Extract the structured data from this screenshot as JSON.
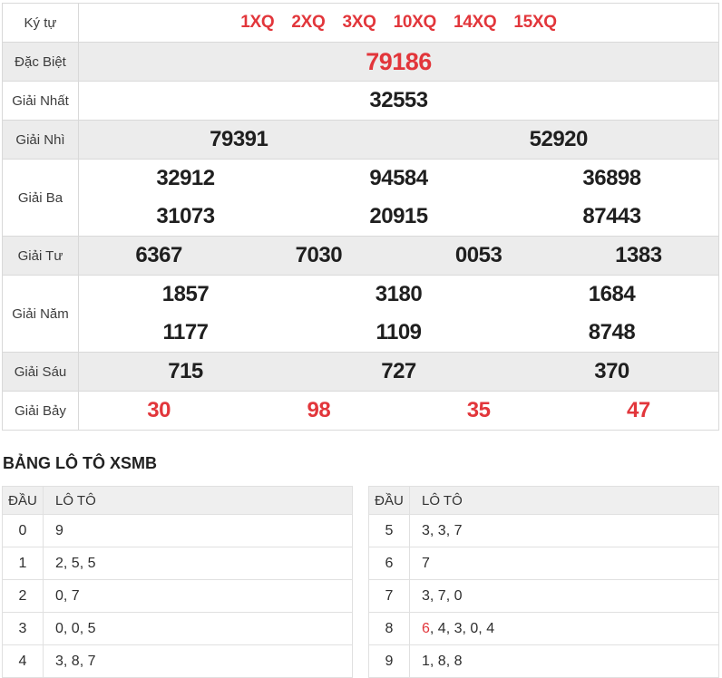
{
  "page": {
    "accent_red": "#e2363b",
    "row_gray": "#ececec",
    "border_color": "#d9d9d9"
  },
  "results_table": {
    "rows": [
      {
        "key": "ky-tu",
        "label": "Ký tự",
        "style": "kytu",
        "cols": 6,
        "values": [
          "1XQ",
          "2XQ",
          "3XQ",
          "10XQ",
          "14XQ",
          "15XQ"
        ]
      },
      {
        "key": "dac-biet",
        "label": "Đặc Biệt",
        "style": "special",
        "cols": 1,
        "values": [
          "79186"
        ]
      },
      {
        "key": "giai-nhat",
        "label": "Giải Nhất",
        "cols": 1,
        "values": [
          "32553"
        ]
      },
      {
        "key": "giai-nhi",
        "label": "Giải Nhì",
        "cols": 2,
        "values": [
          "79391",
          "52920"
        ]
      },
      {
        "key": "giai-ba",
        "label": "Giải Ba",
        "cols": 3,
        "values": [
          "32912",
          "94584",
          "36898",
          "31073",
          "20915",
          "87443"
        ]
      },
      {
        "key": "giai-tu",
        "label": "Giải Tư",
        "cols": 4,
        "values": [
          "6367",
          "7030",
          "0053",
          "1383"
        ]
      },
      {
        "key": "giai-nam",
        "label": "Giải Năm",
        "cols": 3,
        "values": [
          "1857",
          "3180",
          "1684",
          "1177",
          "1109",
          "8748"
        ]
      },
      {
        "key": "giai-sau",
        "label": "Giải Sáu",
        "cols": 3,
        "values": [
          "715",
          "727",
          "370"
        ]
      },
      {
        "key": "giai-bay",
        "label": "Giải Bảy",
        "style": "redrow",
        "cols": 4,
        "values": [
          "30",
          "98",
          "35",
          "47"
        ]
      }
    ]
  },
  "loto_section": {
    "title": "BẢNG LÔ TÔ XSMB",
    "col_dau": "ĐẦU",
    "col_loto": "LÔ TÔ",
    "separator": ", ",
    "left_table": [
      {
        "dau": "0",
        "loto": [
          "9"
        ],
        "red_indices": []
      },
      {
        "dau": "1",
        "loto": [
          "2",
          "5",
          "5"
        ],
        "red_indices": []
      },
      {
        "dau": "2",
        "loto": [
          "0",
          "7"
        ],
        "red_indices": []
      },
      {
        "dau": "3",
        "loto": [
          "0",
          "0",
          "5"
        ],
        "red_indices": []
      },
      {
        "dau": "4",
        "loto": [
          "3",
          "8",
          "7"
        ],
        "red_indices": []
      }
    ],
    "right_table": [
      {
        "dau": "5",
        "loto": [
          "3",
          "3",
          "7"
        ],
        "red_indices": []
      },
      {
        "dau": "6",
        "loto": [
          "7"
        ],
        "red_indices": []
      },
      {
        "dau": "7",
        "loto": [
          "3",
          "7",
          "0"
        ],
        "red_indices": []
      },
      {
        "dau": "8",
        "loto": [
          "6",
          "4",
          "3",
          "0",
          "4"
        ],
        "red_indices": [
          0
        ]
      },
      {
        "dau": "9",
        "loto": [
          "1",
          "8",
          "8"
        ],
        "red_indices": []
      }
    ]
  }
}
